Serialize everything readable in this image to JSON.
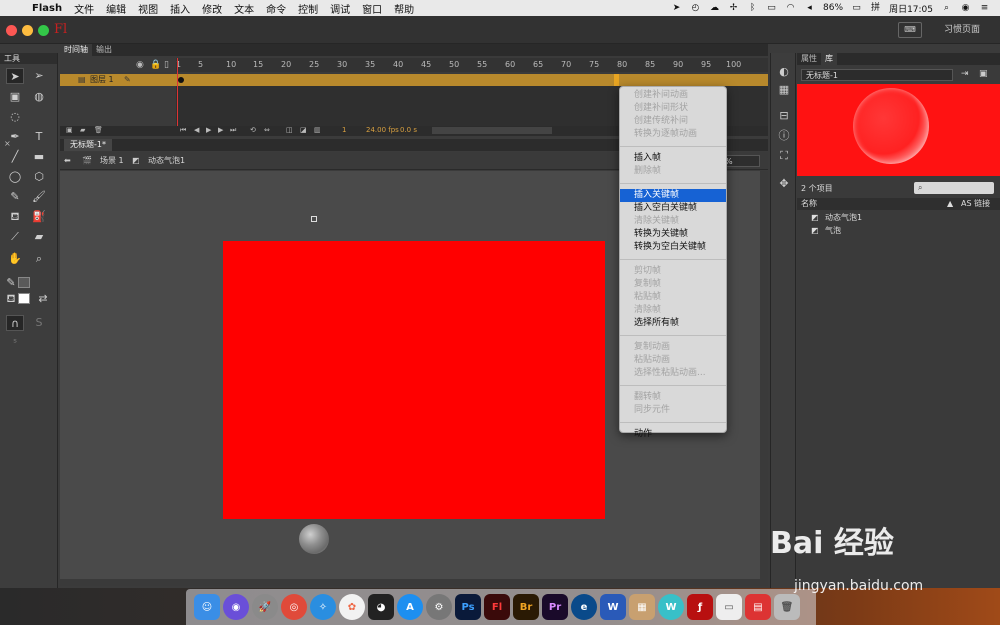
{
  "menubar": {
    "app": "Flash",
    "items": [
      "文件",
      "编辑",
      "视图",
      "插入",
      "修改",
      "文本",
      "命令",
      "控制",
      "调试",
      "窗口",
      "帮助"
    ],
    "battery": "86%",
    "clock": "周日17:05"
  },
  "window": {
    "logo": "Fl",
    "workspace": "习惯页面"
  },
  "tools": {
    "header": "工具"
  },
  "timeline": {
    "tabs": [
      "时间轴",
      "输出"
    ],
    "layer": "图层 1",
    "ruler": [
      "1",
      "5",
      "10",
      "15",
      "20",
      "25",
      "30",
      "35",
      "40",
      "45",
      "50",
      "55",
      "60",
      "65",
      "70",
      "75",
      "80",
      "85",
      "90",
      "95",
      "100"
    ],
    "frame": "1",
    "fps": "24.00 fps",
    "time": "0.0 s"
  },
  "document": {
    "tab": "无标题-1*",
    "scene": "场景 1",
    "symbol": "动态气泡1",
    "zoom": "%"
  },
  "library": {
    "tabs": [
      "属性",
      "库"
    ],
    "doc": "无标题-1",
    "count": "2 个项目",
    "col_name": "名称",
    "col_link": "AS 链接",
    "items": [
      "动态气泡1",
      "气泡"
    ]
  },
  "context_menu": {
    "groups": [
      [
        "创建补间动画",
        "创建补间形状",
        "创建传统补间",
        "转换为逐帧动画"
      ],
      [
        "插入帧",
        "删除帧"
      ],
      [
        "插入关键帧",
        "插入空白关键帧",
        "清除关键帧",
        "转换为关键帧",
        "转换为空白关键帧"
      ],
      [
        "剪切帧",
        "复制帧",
        "粘贴帧",
        "清除帧",
        "选择所有帧"
      ],
      [
        "复制动画",
        "粘贴动画",
        "选择性粘贴动画..."
      ],
      [
        "翻转帧",
        "同步元件"
      ],
      [
        "动作"
      ]
    ],
    "highlighted": "插入关键帧"
  },
  "dock": {
    "apps": [
      "Ps",
      "Fl",
      "Br",
      "Pr"
    ]
  },
  "watermark": {
    "logo": "Bai 经验",
    "url": "jingyan.baidu.com"
  },
  "colors": {
    "stage_shape": "#ff0000",
    "menu_highlight": "#1662d4",
    "layer_row": "#b8892c"
  }
}
